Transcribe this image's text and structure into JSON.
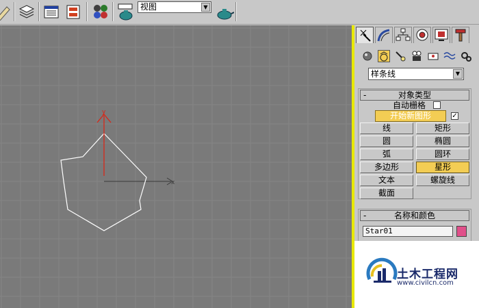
{
  "toolbar": {
    "view_select": {
      "value": "视图"
    }
  },
  "command_panel": {
    "tabs": [
      "create-tab",
      "modify-tab",
      "hierarchy-tab",
      "motion-tab",
      "display-tab",
      "utilities-tab"
    ],
    "active_tab": "create-tab",
    "category_select": {
      "value": "样条线"
    },
    "object_type": {
      "header": "对象类型",
      "auto_grid_label": "自动栅格",
      "auto_grid_checked": false,
      "start_new_shape_label": "开始新图形",
      "start_new_shape_checked": true,
      "checkmark": "✓",
      "buttons": [
        {
          "label": "线"
        },
        {
          "label": "矩形"
        },
        {
          "label": "圆"
        },
        {
          "label": "椭圆"
        },
        {
          "label": "弧"
        },
        {
          "label": "圆环"
        },
        {
          "label": "多边形"
        },
        {
          "label": "星形",
          "active": true
        },
        {
          "label": "文本"
        },
        {
          "label": "螺旋线"
        },
        {
          "label": "截面"
        }
      ]
    },
    "name_and_color": {
      "header": "名称和颜色",
      "name_value": "Star01",
      "color": "#e0508a"
    },
    "collapse_glyph": "-"
  },
  "viewport": {
    "axis_labels": {
      "x": "x",
      "y": "y"
    },
    "colors": {
      "background": "#7a7a7a",
      "grid": "#858585",
      "star": "#ffffff",
      "y_axis": "#e02010",
      "x_axis": "#3a3a3a",
      "active_border": "#e8e800"
    }
  },
  "watermark": {
    "title": "土木工程网",
    "url": "www.civilcn.com"
  }
}
